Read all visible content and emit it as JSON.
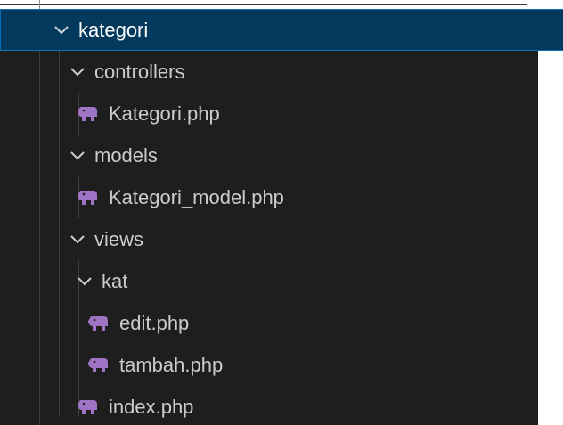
{
  "tree": {
    "folder_kategori": "kategori",
    "folder_controllers": "controllers",
    "file_kategori_php": "Kategori.php",
    "folder_models": "models",
    "file_kategori_model_php": "Kategori_model.php",
    "folder_views": "views",
    "folder_kat": "kat",
    "file_edit_php": "edit.php",
    "file_tambah_php": "tambah.php",
    "file_index_php": "index.php"
  },
  "icons": {
    "folder_chevron": "chevron-down-icon",
    "php_file": "php-elephant-icon"
  },
  "colors": {
    "background": "#1e1e1e",
    "selected_row": "#04395e",
    "selected_border": "#0a6fb8",
    "text": "#cccccc",
    "php_icon": "#a074c4"
  }
}
